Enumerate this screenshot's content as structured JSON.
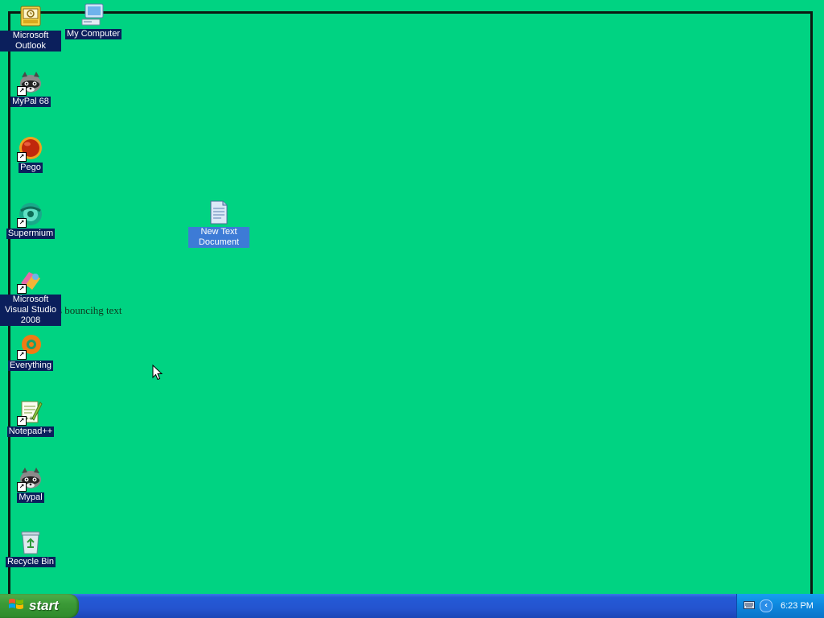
{
  "desktop": {
    "background_color": "#00d382",
    "icons": [
      {
        "name": "desktop-icon-microsoft-outlook",
        "label": "Microsoft Outlook",
        "icon": "outlook-icon",
        "shortcut": false
      },
      {
        "name": "desktop-icon-my-computer",
        "label": "My Computer",
        "icon": "my-computer-icon",
        "shortcut": false
      },
      {
        "name": "desktop-icon-mypal-68",
        "label": "MyPal 68",
        "icon": "mypal-raccoon-icon",
        "shortcut": true
      },
      {
        "name": "desktop-icon-pego",
        "label": "Pego",
        "icon": "pego-icon",
        "shortcut": true
      },
      {
        "name": "desktop-icon-supermium",
        "label": "Supermium",
        "icon": "supermium-icon",
        "shortcut": true
      },
      {
        "name": "desktop-icon-new-text-document",
        "label": "New Text Document",
        "icon": "text-document-icon",
        "shortcut": false
      },
      {
        "name": "desktop-icon-visual-studio-2008",
        "label": "Microsoft Visual Studio 2008",
        "icon": "visual-studio-icon",
        "shortcut": true
      },
      {
        "name": "desktop-icon-everything",
        "label": "Everything",
        "icon": "everything-icon",
        "shortcut": true
      },
      {
        "name": "desktop-icon-notepad-plus-plus",
        "label": "Notepad++",
        "icon": "notepad-plus-plus-icon",
        "shortcut": true
      },
      {
        "name": "desktop-icon-mypal",
        "label": "Mypal",
        "icon": "mypal-raccoon-icon",
        "shortcut": true
      },
      {
        "name": "desktop-icon-recycle-bin",
        "label": "Recycle Bin",
        "icon": "recycle-bin-icon",
        "shortcut": false
      }
    ],
    "bouncing_text": "s bouncihg text"
  },
  "taskbar": {
    "start_label": "start",
    "clock": "6:23 PM",
    "tray_expand_glyph": "‹"
  }
}
